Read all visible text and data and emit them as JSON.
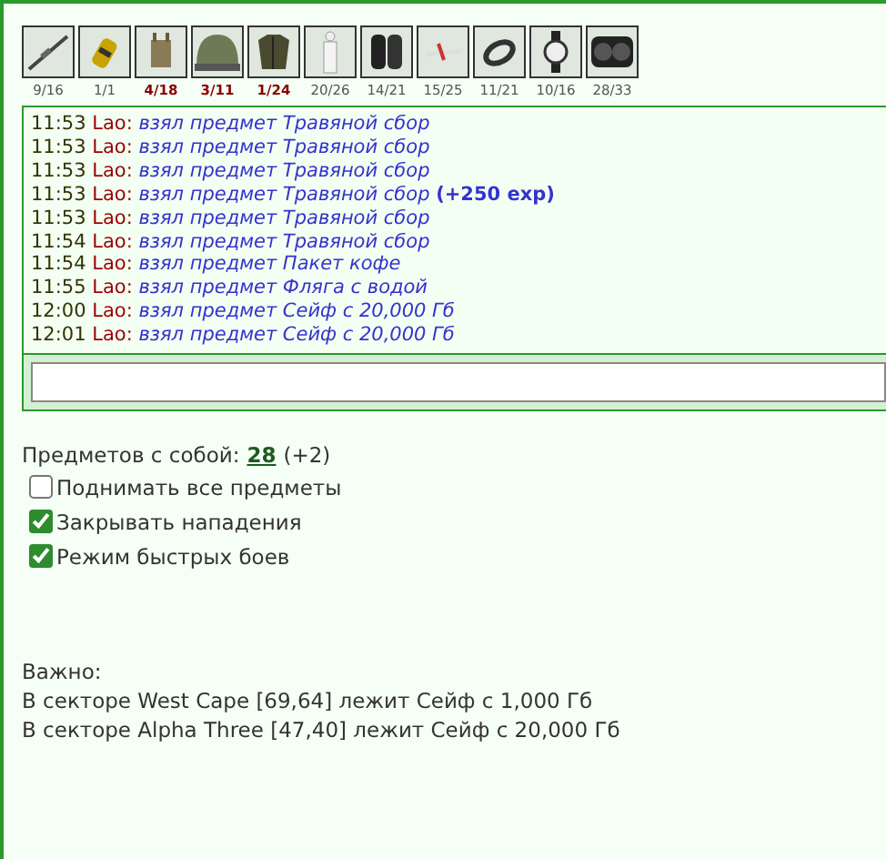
{
  "items": [
    {
      "kind": "rifle",
      "count": "9/16",
      "alert": false
    },
    {
      "kind": "grenade",
      "count": "1/1",
      "alert": false
    },
    {
      "kind": "vest",
      "count": "4/18",
      "alert": true
    },
    {
      "kind": "helmet",
      "count": "3/11",
      "alert": true
    },
    {
      "kind": "armor",
      "count": "1/24",
      "alert": true
    },
    {
      "kind": "suit",
      "count": "20/26",
      "alert": false
    },
    {
      "kind": "boots",
      "count": "14/21",
      "alert": false
    },
    {
      "kind": "plane",
      "count": "15/25",
      "alert": false
    },
    {
      "kind": "bracelet",
      "count": "11/21",
      "alert": false
    },
    {
      "kind": "watch",
      "count": "10/16",
      "alert": false
    },
    {
      "kind": "goggles",
      "count": "28/33",
      "alert": false
    }
  ],
  "log": [
    {
      "time": "11:53",
      "name": "Lao:",
      "action": "взял предмет Травяной сбор"
    },
    {
      "time": "11:53",
      "name": "Lao:",
      "action": "взял предмет Травяной сбор"
    },
    {
      "time": "11:53",
      "name": "Lao:",
      "action": "взял предмет Травяной сбор"
    },
    {
      "time": "11:53",
      "name": "Lao:",
      "action": "взял предмет Травяной сбор",
      "bonus": "(+250 exp)"
    },
    {
      "time": "11:53",
      "name": "Lao:",
      "action": "взял предмет Травяной сбор"
    },
    {
      "time": "11:54",
      "name": "Lao:",
      "action": "взял предмет Травяной сбор"
    },
    {
      "time": "11:54",
      "name": "Lao:",
      "action": "взял предмет Пакет кофе"
    },
    {
      "time": "11:55",
      "name": "Lao:",
      "action": "взял предмет Фляга с водой"
    },
    {
      "time": "12:00",
      "name": "Lao:",
      "action": "взял предмет Сейф с 20,000 Гб"
    },
    {
      "time": "12:01",
      "name": "Lao:",
      "action": "взял предмет Сейф с 20,000 Гб"
    }
  ],
  "carried": {
    "label": "Предметов с собой:",
    "count": "28",
    "extra": "(+2)"
  },
  "options": [
    {
      "label": "Поднимать все предметы",
      "checked": false
    },
    {
      "label": "Закрывать нападения",
      "checked": true
    },
    {
      "label": "Режим быстрых боев",
      "checked": true
    }
  ],
  "notice": {
    "title": "Важно:",
    "lines": [
      "В секторе West Cape [69,64] лежит Сейф с 1,000 Гб",
      "В секторе Alpha Three [47,40] лежит Сейф с 20,000 Гб"
    ]
  }
}
